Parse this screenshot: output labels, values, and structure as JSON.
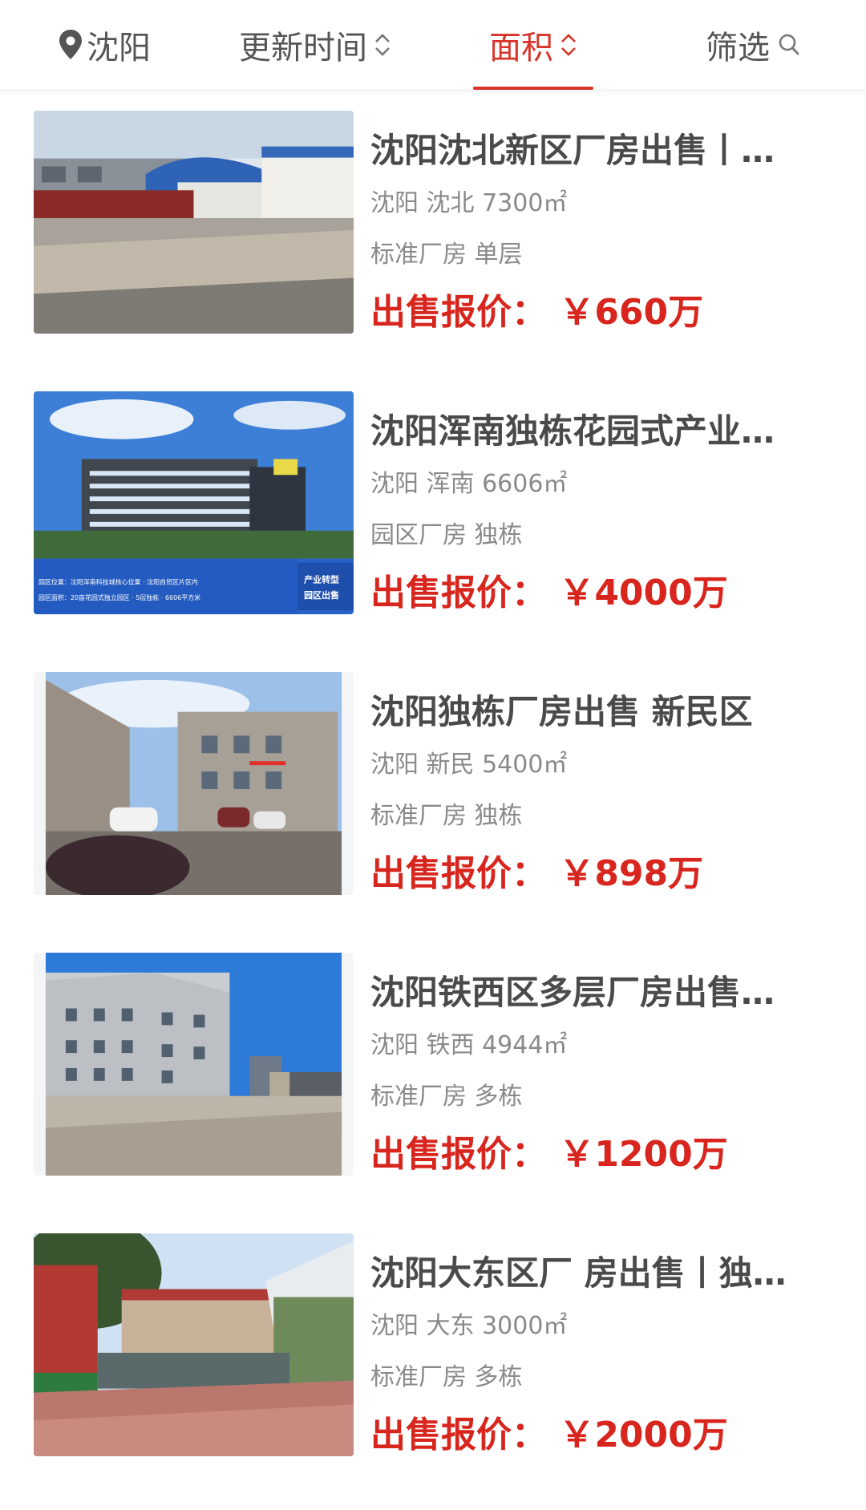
{
  "tabs": {
    "city": "沈阳",
    "update_time": "更新时间",
    "area": "面积",
    "filter": "筛选"
  },
  "listings": [
    {
      "title": "沈阳沈北新区厂房出售丨…",
      "location": "沈阳 沈北 7300㎡",
      "type": "标准厂房 单层",
      "price": "出售报价： ￥660万"
    },
    {
      "title": "沈阳浑南独栋花园式产业…",
      "location": "沈阳 浑南 6606㎡",
      "type": "园区厂房 独栋",
      "price": "出售报价： ￥4000万",
      "image_text": {
        "tag1": "产业转型",
        "tag2": "园区出售",
        "line1": "园区位置：沈阳浑南科技城核心位置 · 沈阳自贸区片区内",
        "line2": "园区面积：20亩花园式独立园区 · 5层独栋 · 6606平方米"
      }
    },
    {
      "title": "沈阳独栋厂房出售 新民区",
      "location": "沈阳 新民 5400㎡",
      "type": "标准厂房 独栋",
      "price": "出售报价： ￥898万"
    },
    {
      "title": "沈阳铁西区多层厂房出售…",
      "location": "沈阳 铁西 4944㎡",
      "type": "标准厂房 多栋",
      "price": "出售报价： ￥1200万"
    },
    {
      "title": "沈阳大东区厂 房出售丨独…",
      "location": "沈阳 大东 3000㎡",
      "type": "标准厂房 多栋",
      "price": "出售报价： ￥2000万"
    }
  ],
  "colors": {
    "accent": "#d8342a",
    "price": "#d8261e",
    "title": "#4a4a4a",
    "meta": "#8a8a8a"
  }
}
